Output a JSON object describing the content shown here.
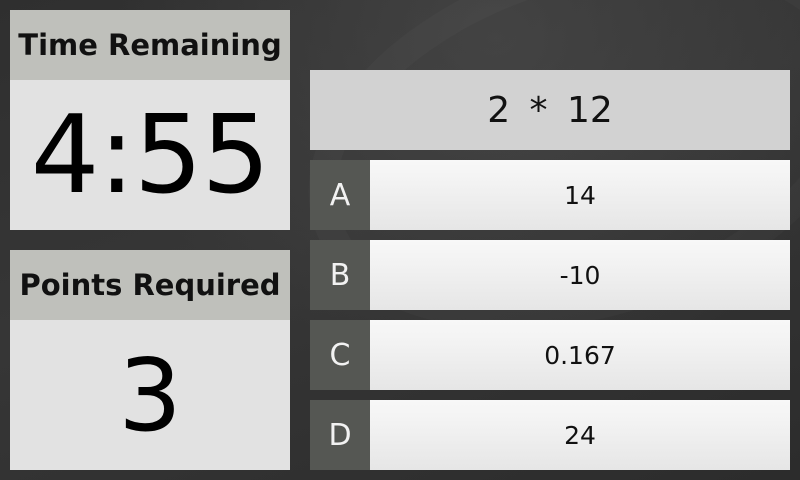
{
  "timer": {
    "label": "Time Remaining",
    "value": "4:55"
  },
  "points": {
    "label": "Points Required",
    "value": "3"
  },
  "question": {
    "text": "2 * 12"
  },
  "answers": [
    {
      "letter": "A",
      "value": "14"
    },
    {
      "letter": "B",
      "value": "-10"
    },
    {
      "letter": "C",
      "value": "0.167"
    },
    {
      "letter": "D",
      "value": "24"
    }
  ],
  "colors": {
    "background": "#323232",
    "panel_header": "#bfc0bb",
    "panel_body": "#e2e2e2",
    "question_bg": "#d2d2d2",
    "letter_bg": "#555753",
    "answer_bg": "#f0f0f0"
  }
}
